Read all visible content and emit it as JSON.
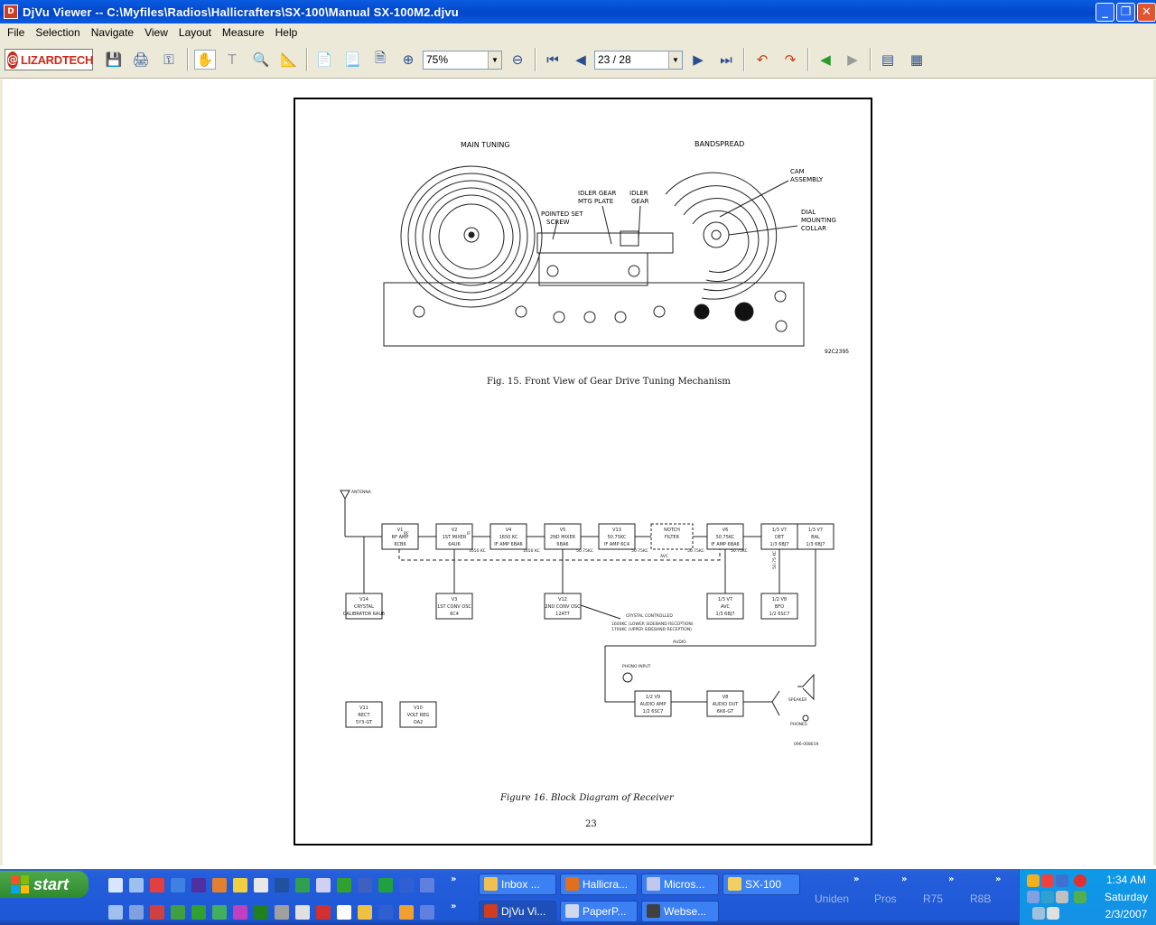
{
  "window": {
    "title": "DjVu Viewer -- C:\\Myfiles\\Radios\\Hallicrafters\\SX-100\\Manual SX-100M2.djvu"
  },
  "menu": [
    "File",
    "Selection",
    "Navigate",
    "View",
    "Layout",
    "Measure",
    "Help"
  ],
  "toolbar": {
    "logo": "LIZARDTECH",
    "zoom": "75%",
    "page": "23 / 28"
  },
  "document": {
    "fig15": {
      "labels": [
        "MAIN TUNING",
        "BANDSPREAD",
        "CAM",
        "ASSEMBLY",
        "IDLER GEAR",
        "MTG PLATE",
        "IDLER",
        "GEAR",
        "POINTED SET",
        "SCREW",
        "DIAL",
        "MOUNTING",
        "COLLAR",
        "92C2395"
      ],
      "caption": "Fig. 15. Front View of Gear Drive Tuning Mechanism"
    },
    "fig16": {
      "blocks": [
        {
          "id": "V1",
          "l1": "V1",
          "l2": "RF AMP",
          "l3": "6CB6"
        },
        {
          "id": "V2",
          "l1": "V2",
          "l2": "1ST MIXER",
          "l3": "6AU6"
        },
        {
          "id": "V4",
          "l1": "V4",
          "l2": "1650 KC",
          "l3": "IF AMP 6BA6"
        },
        {
          "id": "V5",
          "l1": "V5",
          "l2": "2ND MIXER",
          "l3": "6BA6"
        },
        {
          "id": "V13",
          "l1": "V13",
          "l2": "50.75KC",
          "l3": "IF AMP 6C4"
        },
        {
          "id": "notch",
          "l1": "NOTCH",
          "l2": "FILTER",
          "l3": ""
        },
        {
          "id": "V6",
          "l1": "V6",
          "l2": "50.75KC",
          "l3": "IF AMP 6BA6"
        },
        {
          "id": "V7det",
          "l1": "1/3 V7",
          "l2": "DET",
          "l3": "1/3 6BJ7"
        },
        {
          "id": "V7bal",
          "l1": "1/3 V7",
          "l2": "BAL",
          "l3": "1/3 6BJ7"
        },
        {
          "id": "V14",
          "l1": "V14",
          "l2": "CRYSTAL",
          "l3": "CALIBRATOR 6AU6"
        },
        {
          "id": "V3",
          "l1": "V3",
          "l2": "1ST CONV OSC",
          "l3": "6C4"
        },
        {
          "id": "V12",
          "l1": "V12",
          "l2": "2ND CONV OSC",
          "l3": "12AT7"
        },
        {
          "id": "V7avc",
          "l1": "1/3 V7",
          "l2": "AVC",
          "l3": "1/3 6BJ7"
        },
        {
          "id": "V8",
          "l1": "1/2 V8",
          "l2": "BFO",
          "l3": "1/2 6SC7"
        },
        {
          "id": "V9",
          "l1": "1/2 V9",
          "l2": "AUDIO AMP",
          "l3": "1/2 6SC7"
        },
        {
          "id": "V10out",
          "l1": "V8",
          "l2": "AUDIO OUT",
          "l3": "6K6-GT"
        },
        {
          "id": "V11",
          "l1": "V11",
          "l2": "RECT",
          "l3": "5Y3-GT"
        },
        {
          "id": "V10",
          "l1": "V10",
          "l2": "VOLT REG",
          "l3": "OA2"
        }
      ],
      "labels": [
        "ANTENNA",
        "RF",
        "IF",
        "1650 KC",
        "1650 KC",
        "50.75KC",
        "50.75KC",
        "50.75KC",
        "50.75KC",
        "AVC",
        "AUDIO",
        "PHONO INPUT",
        "SPEAKER",
        "PHONES",
        "CRYSTAL CONTROLLED",
        "1600KC (LOWER SIDEBAND RECEPTION)",
        "1700KC (UPPER SIDEBAND RECEPTION)",
        "50.75 KC",
        "096-008019"
      ],
      "caption": "Figure 16.  Block Diagram of Receiver"
    },
    "page_number": "23"
  },
  "taskbar": {
    "start": "start",
    "items_top": [
      "Inbox ...",
      "Hallicra...",
      "Micros...",
      "SX-100"
    ],
    "items_bottom": [
      "DjVu Vi...",
      "PaperP...",
      "Webse..."
    ],
    "groups": [
      "Uniden",
      "Pros",
      "R75",
      "R8B"
    ],
    "clock": {
      "time": "1:34 AM",
      "day": "Saturday",
      "date": "2/3/2007"
    }
  }
}
